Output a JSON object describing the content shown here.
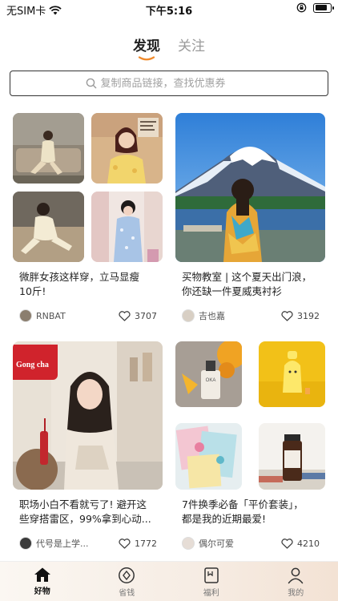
{
  "status": {
    "carrier": "无SIM卡",
    "time": "下午5:16",
    "battery_level": 0.85
  },
  "top_tabs": [
    {
      "label": "发现",
      "active": true
    },
    {
      "label": "关注",
      "active": false
    }
  ],
  "search": {
    "placeholder": "复制商品链接，查找优惠券",
    "icon": "search-icon"
  },
  "feed": [
    {
      "title_line1": "微胖女孩这样穿，立马显瘦",
      "title_line2": "10斤!",
      "author": "RNBAT",
      "likes": "3707",
      "image": "four-photo-collage-girls-outfits"
    },
    {
      "title_line1": "买物教室 | 这个夏天出门浪，",
      "title_line2": "你还缺一件夏威夷衬衫",
      "author": "吉也嘉",
      "likes": "3192",
      "image": "mount-fuji-lake-girl"
    },
    {
      "title_line1": "职场小白不看就亏了! 避开这",
      "title_line2": "些穿搭雷区，99%拿到心动...",
      "author": "代号是上学...",
      "likes": "1772",
      "image": "gong-cha-girl",
      "sign_text": "Gong cha"
    },
    {
      "title_line1": "7件换季必备「平价套装」，",
      "title_line2": "都是我的近期最爱!",
      "author": "偶尔可爱",
      "likes": "4210",
      "image": "skincare-products-collage",
      "bottle_text": "OKA"
    }
  ],
  "bottom_nav": [
    {
      "label": "好物",
      "icon": "home-icon",
      "active": true
    },
    {
      "label": "省钱",
      "icon": "coin-diamond-icon",
      "active": false
    },
    {
      "label": "福利",
      "icon": "bookmark-icon",
      "active": false
    },
    {
      "label": "我的",
      "icon": "user-icon",
      "active": false
    }
  ],
  "colors": {
    "accent_underline": "#f08a2b",
    "text_primary": "#222222",
    "text_muted": "#9a9a9a"
  }
}
